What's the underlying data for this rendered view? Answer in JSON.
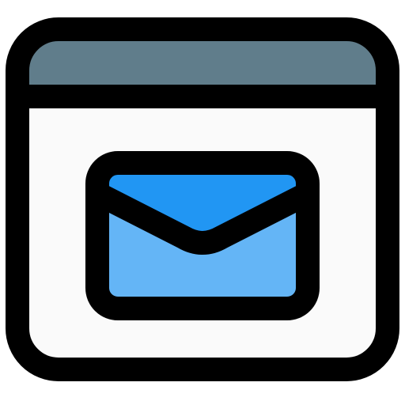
{
  "icon": {
    "name": "browser-mail-icon",
    "colors": {
      "outline": "#000000",
      "title_bar": "#607D8B",
      "window_body": "#FAFAFA",
      "envelope_flap": "#2196F3",
      "envelope_body": "#64B5F6"
    }
  }
}
